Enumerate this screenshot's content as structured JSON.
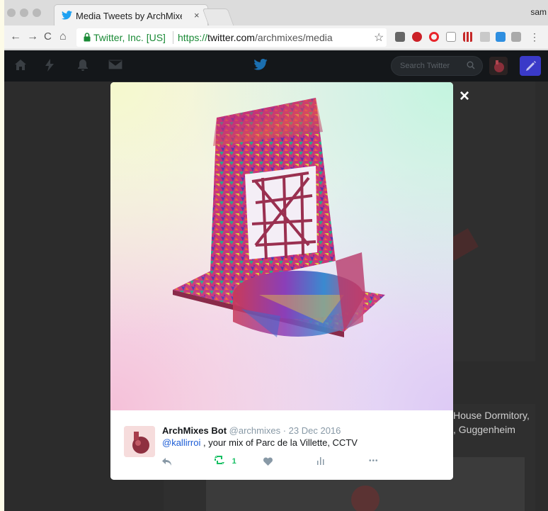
{
  "browser": {
    "tab_title": "Media Tweets by ArchMixes Bot",
    "tab_close": "×",
    "profile": "sam",
    "nav": {
      "back": "←",
      "forward": "→",
      "reload": "C",
      "home": "⌂"
    },
    "org_label": "Twitter, Inc. [US]",
    "url_scheme": "https://",
    "url_host": "twitter.com",
    "url_path": "/archmixes/media",
    "star": "☆",
    "extensions": [
      "text-extension-icon",
      "pinterest-icon",
      "opera-icon",
      "page-icon",
      "bars-icon",
      "drive-icon",
      "vimeo-icon",
      "camera-icon"
    ]
  },
  "twitter_nav": {
    "search_placeholder": "Search Twitter",
    "search_icon": "🔍"
  },
  "background_page": {
    "caption_line1": "House Dormitory,",
    "caption_line2": ", Guggenheim"
  },
  "modal": {
    "close": "×",
    "tweet": {
      "name": "ArchMixes Bot",
      "handle": "@archmixes",
      "separator": " · ",
      "date": "23 Dec 2016",
      "mention": "@kallirroi",
      "text": " , your mix of Parc de la Villette, CCTV",
      "reply_icon": "↰",
      "retweet_icon": "⇆",
      "retweet_count": "1",
      "like_icon": "♥",
      "analytics_icon": "ıl",
      "more_icon": "•••"
    }
  },
  "colors": {
    "twitter_bar": "#14171a",
    "retweet_green": "#17bf63",
    "mention_blue": "#1b5cd6",
    "secure_green": "#1a8a36",
    "twitter_blue": "#1da1f2"
  }
}
